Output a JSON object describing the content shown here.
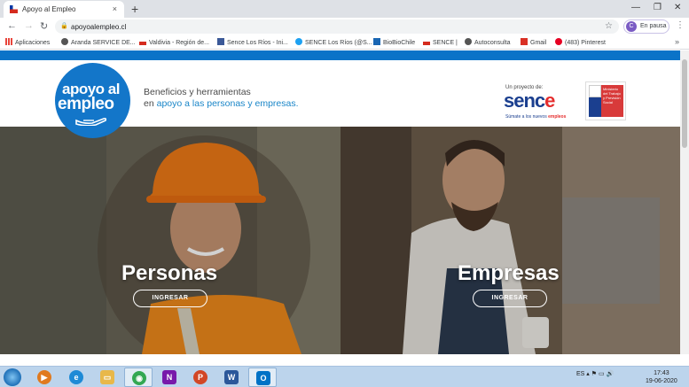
{
  "browser": {
    "tab_title": "Apoyo al Empleo",
    "tab_close": "×",
    "new_tab": "+",
    "window_controls": [
      "—",
      "❐",
      "✕"
    ],
    "url": "apoyoalempleo.cl",
    "profile_initial": "C",
    "profile_label": "En pausa",
    "menu": "⋮",
    "bookmarks_more": "»"
  },
  "bookmarks": [
    {
      "label": "Aplicaciones",
      "icon": "apps-icon",
      "color": "#e8453c"
    },
    {
      "label": "Aranda SERVICE DE...",
      "icon": "globe-icon",
      "color": "#555555"
    },
    {
      "label": "Valdivia - Región de...",
      "icon": "chile-flag-icon",
      "color": "#d52b1e"
    },
    {
      "label": "Sence Los Ríos - Ini...",
      "icon": "facebook-icon",
      "color": "#3b5998"
    },
    {
      "label": "SENCE Los Ríos (@S...",
      "icon": "twitter-icon",
      "color": "#1da1f2"
    },
    {
      "label": "BioBioChile",
      "icon": "biobio-icon",
      "color": "#1a66b3"
    },
    {
      "label": "SENCE |",
      "icon": "chile-flag-icon",
      "color": "#d52b1e"
    },
    {
      "label": "Autoconsulta",
      "icon": "globe-icon",
      "color": "#555555"
    },
    {
      "label": "Gmail",
      "icon": "gmail-icon",
      "color": "#d93025"
    },
    {
      "label": "(483) Pinterest",
      "icon": "pinterest-icon",
      "color": "#e60023"
    }
  ],
  "header": {
    "logo_line1": "apoyo al",
    "logo_line2": "empleo",
    "tagline_line1": "Beneficios y herramientas",
    "tagline_prefix": "en ",
    "tagline_highlight": "apoyo a las personas y empresas.",
    "sence_small": "Un proyecto de:",
    "sence_word_a": "senc",
    "sence_word_b": "e",
    "sence_sub_a": "Súmate a los nuevos ",
    "sence_sub_b": "empleos",
    "ministerio_text": "Ministerio del Trabajo y Previsión Social"
  },
  "panels": {
    "personas": {
      "title": "Personas",
      "button": "INGRESAR"
    },
    "empresas": {
      "title": "Empresas",
      "button": "INGRESAR"
    }
  },
  "taskbar": {
    "apps": [
      {
        "name": "media-player-icon",
        "glyph": "▶",
        "color": "#e07a1f"
      },
      {
        "name": "internet-explorer-icon",
        "glyph": "e",
        "color": "#1e8ad6"
      },
      {
        "name": "file-explorer-icon",
        "glyph": "▭",
        "color": "#e8b84a"
      },
      {
        "name": "chrome-icon",
        "glyph": "◉",
        "color": "#34a853"
      },
      {
        "name": "onenote-icon",
        "glyph": "N",
        "color": "#7719aa"
      },
      {
        "name": "powerpoint-icon",
        "glyph": "P",
        "color": "#d24726"
      },
      {
        "name": "word-icon",
        "glyph": "W",
        "color": "#2b579a"
      },
      {
        "name": "outlook-icon",
        "glyph": "O",
        "color": "#0072c6"
      }
    ],
    "language": "ES",
    "time": "17:43",
    "date": "19-06-2020"
  },
  "colors": {
    "brand_blue": "#0a73c8",
    "sence_blue": "#1b3f8f",
    "sence_red": "#e52d2d"
  }
}
